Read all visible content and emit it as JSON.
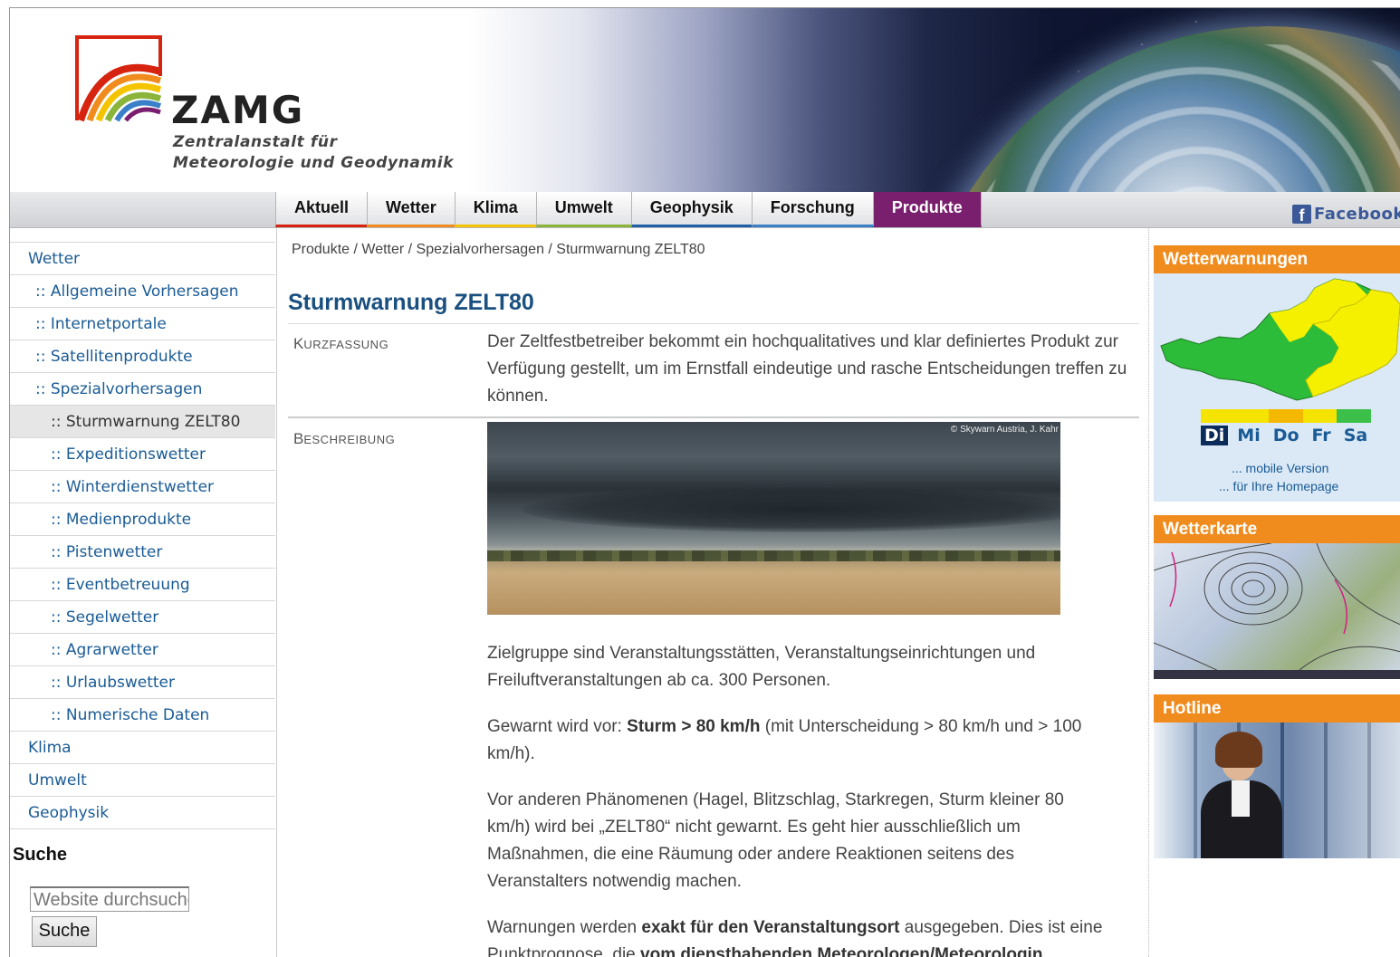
{
  "header": {
    "logo_word": "ZAMG",
    "logo_sub_line1": "Zentralanstalt für",
    "logo_sub_line2": "Meteorologie und Geodynamik"
  },
  "nav": {
    "tabs": [
      {
        "label": "Aktuell",
        "color": "#d62410"
      },
      {
        "label": "Wetter",
        "color": "#f08c1e"
      },
      {
        "label": "Klima",
        "color": "#f5c400"
      },
      {
        "label": "Umwelt",
        "color": "#8ab43a"
      },
      {
        "label": "Geophysik",
        "color": "#1f5fa8"
      },
      {
        "label": "Forschung",
        "color": "#3a80c8"
      },
      {
        "label": "Produkte",
        "color": "#7a1e6e"
      }
    ],
    "active_tab": "Produkte",
    "facebook_label": "Facebook",
    "facebook_icon": "facebook-icon"
  },
  "sidebar": {
    "items": [
      {
        "label": "Wetter",
        "level": 0
      },
      {
        "label": ":: Allgemeine Vorhersagen",
        "level": 1
      },
      {
        "label": ":: Internetportale",
        "level": 1
      },
      {
        "label": ":: Satellitenprodukte",
        "level": 1
      },
      {
        "label": ":: Spezialvorhersagen",
        "level": 1
      },
      {
        "label": ":: Sturmwarnung ZELT80",
        "level": 2,
        "current": true
      },
      {
        "label": ":: Expeditionswetter",
        "level": 2
      },
      {
        "label": ":: Winterdienstwetter",
        "level": 2
      },
      {
        "label": ":: Medienprodukte",
        "level": 2
      },
      {
        "label": ":: Pistenwetter",
        "level": 2
      },
      {
        "label": ":: Eventbetreuung",
        "level": 2
      },
      {
        "label": ":: Segelwetter",
        "level": 2
      },
      {
        "label": ":: Agrarwetter",
        "level": 2
      },
      {
        "label": ":: Urlaubswetter",
        "level": 2
      },
      {
        "label": ":: Numerische Daten",
        "level": 2
      },
      {
        "label": "Klima",
        "level": 0
      },
      {
        "label": "Umwelt",
        "level": 0
      },
      {
        "label": "Geophysik",
        "level": 0
      }
    ],
    "search_title": "Suche",
    "search_placeholder": "Website durchsuchen",
    "search_button": "Suche"
  },
  "main": {
    "breadcrumb": "Produkte / Wetter / Spezialvorhersagen / Sturmwarnung ZELT80",
    "title": "Sturmwarnung ZELT80",
    "label_kurz_first": "K",
    "label_kurz_rest": "URZFASSUNG",
    "label_besch_first": "B",
    "label_besch_rest": "ESCHREIBUNG",
    "kurzfassung": "Der Zeltfestbetreiber bekommt ein hochqualitatives und klar definiertes Produkt zur Verfügung gestellt, um im Ernstfall eindeutige und rasche Entscheidungen treffen zu können.",
    "photo_credit": "© Skywarn Austria, J. Kahr",
    "p1": "Zielgruppe sind Veranstaltungsstätten, Veranstaltungseinrichtungen und Freiluftveranstaltungen ab ca. 300 Personen.",
    "p2_a": "Gewarnt wird vor: ",
    "p2_b": "Sturm > 80 km/h",
    "p2_c": " (mit Unterscheidung > 80 km/h und > 100 km/h).",
    "p3": "Vor anderen Phänomenen (Hagel, Blitzschlag, Starkregen, Sturm kleiner 80 km/h) wird bei „ZELT80“ nicht gewarnt. Es geht hier ausschließlich um Maßnahmen, die eine Räumung oder andere Reaktionen seitens des Veranstalters notwendig machen.",
    "p4_a": "Warnungen werden ",
    "p4_b": "exakt für den Veranstaltungsort",
    "p4_c": " ausgegeben. Dies ist eine Punktprognose, die ",
    "p4_d": "vom diensthabenden Meteorologen/Meteorologin"
  },
  "right": {
    "warn_title": "Wetterwarnungen",
    "days": [
      "Di",
      "Mi",
      "Do",
      "Fr",
      "Sa"
    ],
    "day_colors": [
      "#f5e400",
      "#f5e400",
      "#f5b800",
      "#f5e400",
      "#3cc04a"
    ],
    "selected_day": "Di",
    "link_mobile": "... mobile Version",
    "link_homepage": "... für Ihre Homepage",
    "map_title": "Wetterkarte",
    "hotline_title": "Hotline"
  }
}
